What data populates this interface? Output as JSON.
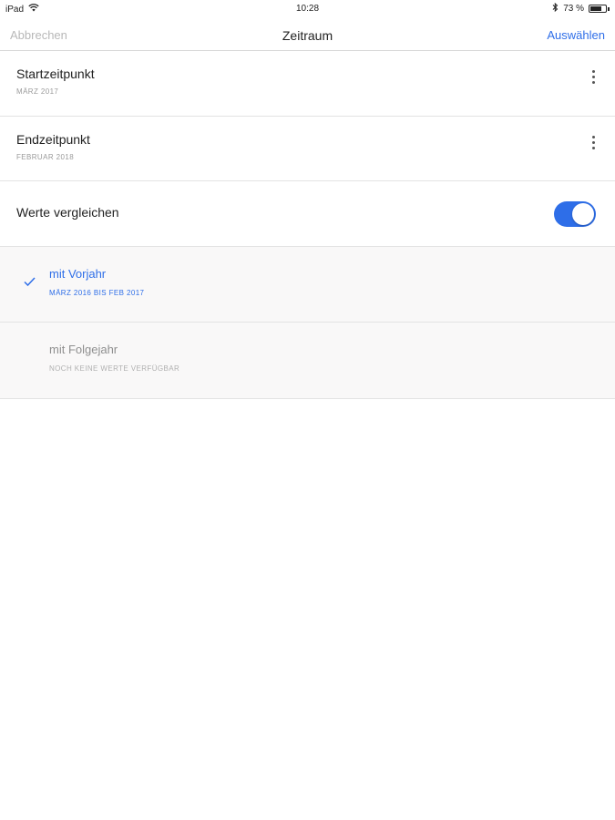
{
  "status_bar": {
    "device": "iPad",
    "time": "10:28",
    "battery": "73 %",
    "battery_level": 0.73,
    "icons": [
      "wifi-icon",
      "bluetooth-icon",
      "battery-icon"
    ]
  },
  "nav": {
    "cancel_label": "Abbrechen",
    "title": "Zeitraum",
    "select_label": "Auswählen"
  },
  "start": {
    "title": "Startzeitpunkt",
    "value": "MÄRZ 2017"
  },
  "end": {
    "title": "Endzeitpunkt",
    "value": "FEBRUAR 2018"
  },
  "compare": {
    "title": "Werte vergleichen",
    "enabled": true
  },
  "options": [
    {
      "title": "mit Vorjahr",
      "subtitle": "MÄRZ 2016 BIS FEB 2017",
      "selected": true
    },
    {
      "title": "mit Folgejahr",
      "subtitle": "NOCH KEINE WERTE VERFÜGBAR",
      "selected": false
    }
  ],
  "colors": {
    "accent": "#2e6ee8",
    "muted_text": "#9a9a9a",
    "disabled_text": "#b8b8b8",
    "option_bg": "#f9f8f8"
  }
}
